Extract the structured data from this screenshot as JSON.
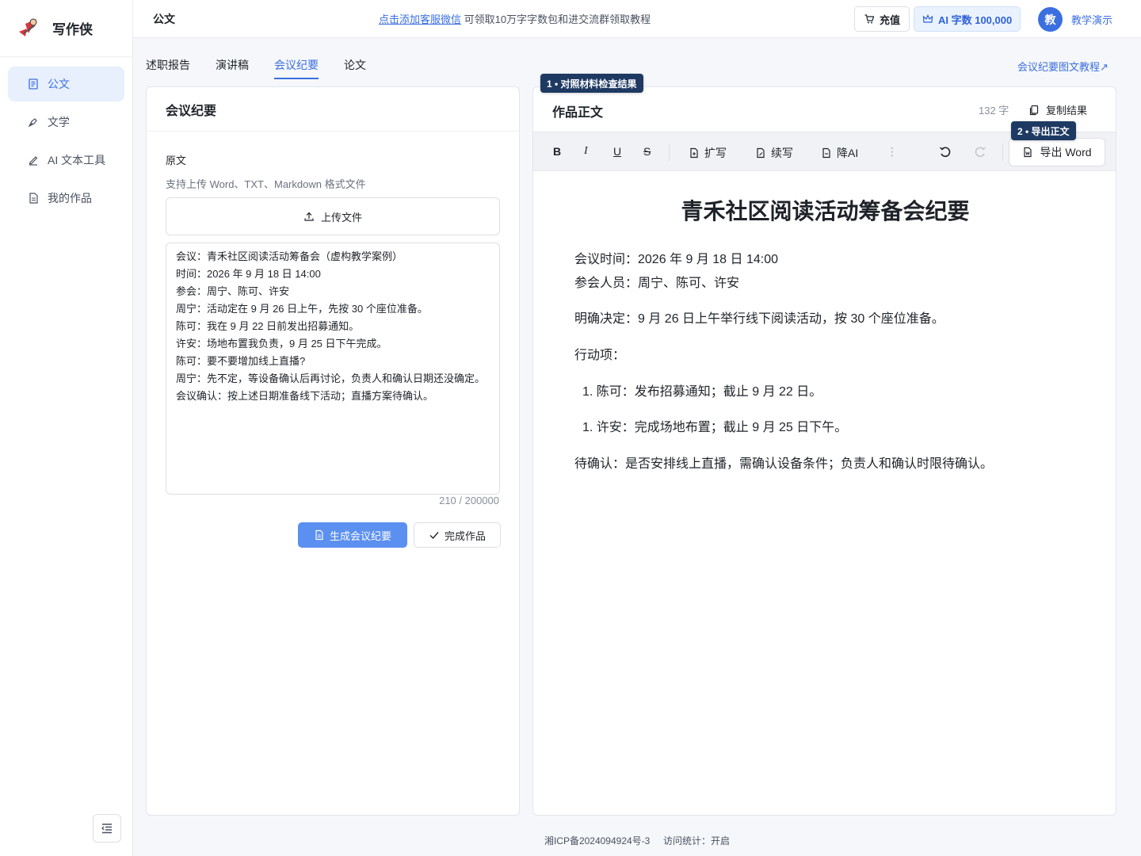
{
  "app": {
    "name": "写作侠"
  },
  "sidebar": {
    "items": [
      {
        "label": "公文",
        "icon": "document-icon",
        "active": true
      },
      {
        "label": "文学",
        "icon": "pen-nib-icon"
      },
      {
        "label": "AI 文本工具",
        "icon": "edit-icon"
      },
      {
        "label": "我的作品",
        "icon": "file-icon"
      }
    ]
  },
  "header": {
    "title": "公文",
    "notice_link": "点击添加客服微信",
    "notice_text": "可领取10万字字数包和进交流群领取教程",
    "recharge_label": "充值",
    "quota_label": "AI 字数 100,000",
    "avatar_text": "教",
    "username": "教学演示"
  },
  "tabs": [
    "述职报告",
    "演讲稿",
    "会议纪要",
    "论文"
  ],
  "active_tab": "会议纪要",
  "tutorial_link": "会议纪要图文教程↗",
  "left_panel": {
    "title": "会议纪要",
    "source_label": "原文",
    "upload_hint": "支持上传 Word、TXT、Markdown 格式文件",
    "upload_label": "上传文件",
    "source_text": "会议：青禾社区阅读活动筹备会（虚构教学案例）\n时间：2026 年 9 月 18 日 14:00\n参会：周宁、陈可、许安\n周宁：活动定在 9 月 26 日上午，先按 30 个座位准备。\n陈可：我在 9 月 22 日前发出招募通知。\n许安：场地布置我负责，9 月 25 日下午完成。\n陈可：要不要增加线上直播?\n周宁：先不定，等设备确认后再讨论，负责人和确认日期还没确定。\n会议确认：按上述日期准备线下活动；直播方案待确认。",
    "char_count": "210 / 200000",
    "generate_label": "生成会议纪要",
    "finish_label": "完成作品"
  },
  "right_panel": {
    "title": "作品正文",
    "word_count": "132 字",
    "copy_label": "复制结果",
    "toolbar": {
      "bold": "B",
      "italic": "I",
      "underline": "U",
      "strike": "S",
      "expand_label": "扩写",
      "continue_label": "续写",
      "deai_label": "降AI",
      "export_label": "导出 Word"
    },
    "doc": {
      "title": "青禾社区阅读活动筹备会纪要",
      "time_line": "会议时间：2026 年 9 月 18 日 14:00",
      "attendees_line": "参会人员：周宁、陈可、许安",
      "decision_line": "明确决定：9 月 26 日上午举行线下阅读活动，按 30 个座位准备。",
      "actions_heading": "行动项：",
      "action_1": "1. 陈可：发布招募通知；截止 9 月 22 日。",
      "action_2": "1. 许安：完成场地布置；截止 9 月 25 日下午。",
      "pending_line": "待确认：是否安排线上直播，需确认设备条件；负责人和确认时限待确认。"
    }
  },
  "callouts": {
    "step1": "1 • 对照材料检查结果",
    "step2": "2 • 导出正文"
  },
  "footer": {
    "icp": "湘ICP备2024094924号-3",
    "stats": "访问统计：开启"
  },
  "colors": {
    "accent": "#3b6fe0",
    "primary_button": "#5b8ff0",
    "callout": "#1e3a63"
  }
}
